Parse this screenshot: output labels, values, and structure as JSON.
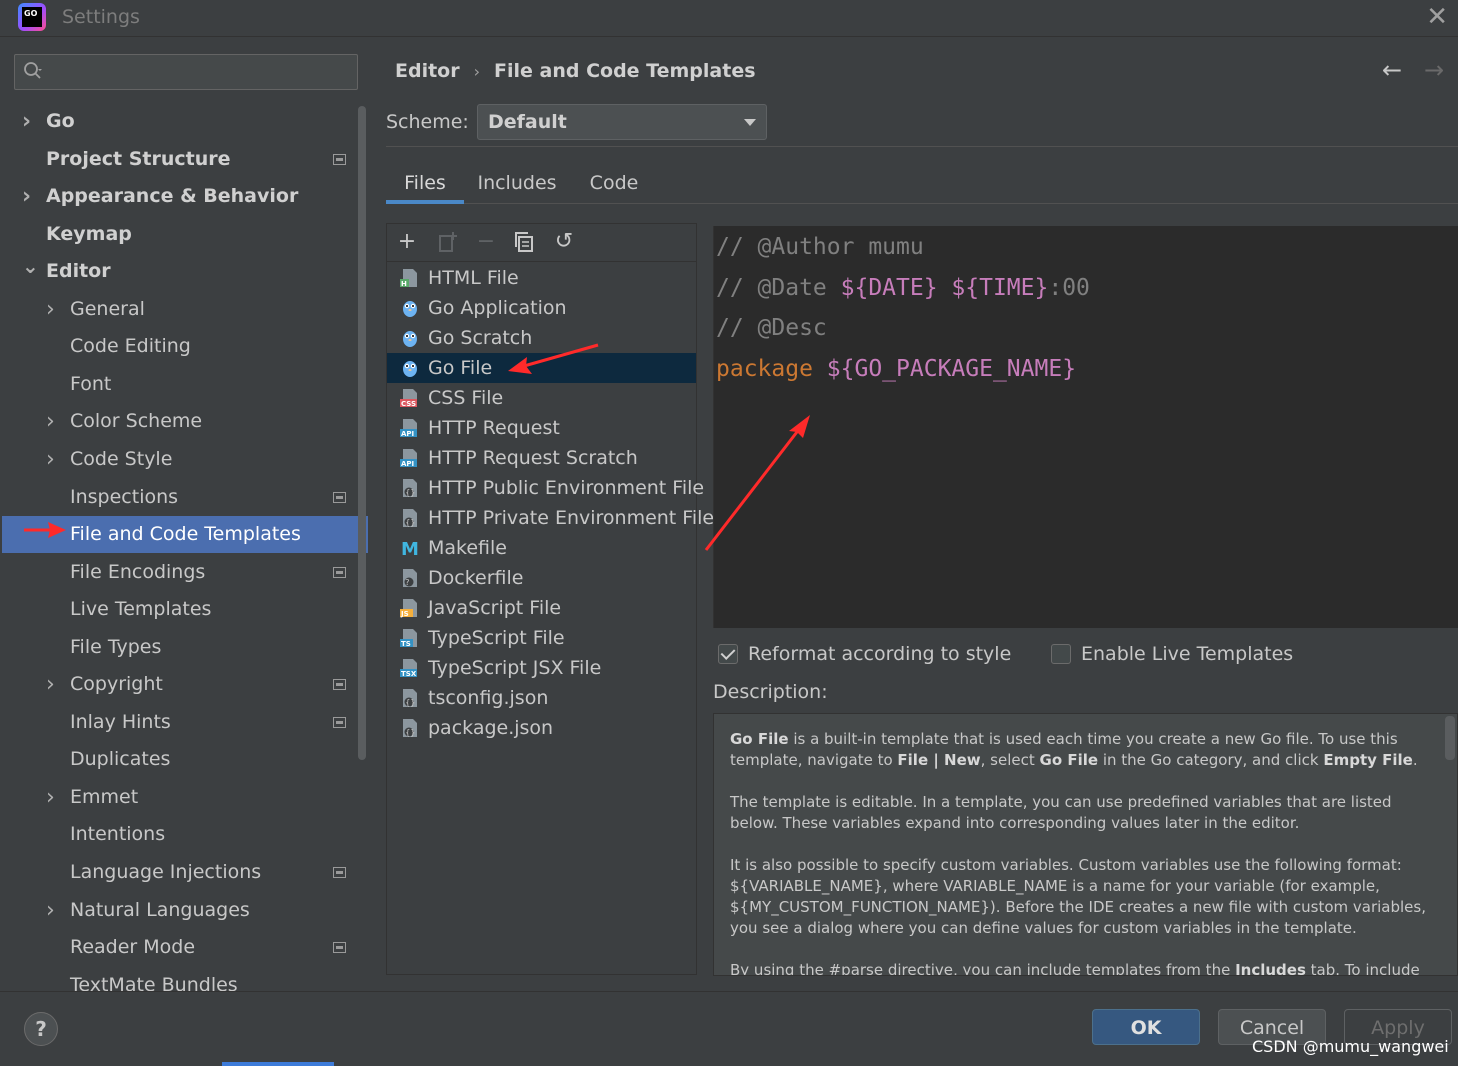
{
  "window": {
    "title": "Settings",
    "logo_text": "GO"
  },
  "sidebar": {
    "search_placeholder": "",
    "items": [
      {
        "label": "Go",
        "level": 0,
        "expandable": true,
        "expanded": false,
        "bold": true,
        "project_icon": false,
        "selected": false
      },
      {
        "label": "Project Structure",
        "level": 0,
        "expandable": false,
        "bold": true,
        "project_icon": true,
        "selected": false
      },
      {
        "label": "Appearance & Behavior",
        "level": 0,
        "expandable": true,
        "expanded": false,
        "bold": true,
        "project_icon": false,
        "selected": false
      },
      {
        "label": "Keymap",
        "level": 0,
        "expandable": false,
        "bold": true,
        "project_icon": false,
        "selected": false
      },
      {
        "label": "Editor",
        "level": 0,
        "expandable": true,
        "expanded": true,
        "bold": true,
        "project_icon": false,
        "selected": false
      },
      {
        "label": "General",
        "level": 1,
        "expandable": true,
        "expanded": false,
        "bold": false,
        "project_icon": false,
        "selected": false
      },
      {
        "label": "Code Editing",
        "level": 1,
        "expandable": false,
        "bold": false,
        "project_icon": false,
        "selected": false
      },
      {
        "label": "Font",
        "level": 1,
        "expandable": false,
        "bold": false,
        "project_icon": false,
        "selected": false
      },
      {
        "label": "Color Scheme",
        "level": 1,
        "expandable": true,
        "expanded": false,
        "bold": false,
        "project_icon": false,
        "selected": false
      },
      {
        "label": "Code Style",
        "level": 1,
        "expandable": true,
        "expanded": false,
        "bold": false,
        "project_icon": false,
        "selected": false
      },
      {
        "label": "Inspections",
        "level": 1,
        "expandable": false,
        "bold": false,
        "project_icon": true,
        "selected": false
      },
      {
        "label": "File and Code Templates",
        "level": 1,
        "expandable": false,
        "bold": false,
        "project_icon": false,
        "selected": true
      },
      {
        "label": "File Encodings",
        "level": 1,
        "expandable": false,
        "bold": false,
        "project_icon": true,
        "selected": false
      },
      {
        "label": "Live Templates",
        "level": 1,
        "expandable": false,
        "bold": false,
        "project_icon": false,
        "selected": false
      },
      {
        "label": "File Types",
        "level": 1,
        "expandable": false,
        "bold": false,
        "project_icon": false,
        "selected": false
      },
      {
        "label": "Copyright",
        "level": 1,
        "expandable": true,
        "expanded": false,
        "bold": false,
        "project_icon": true,
        "selected": false
      },
      {
        "label": "Inlay Hints",
        "level": 1,
        "expandable": false,
        "bold": false,
        "project_icon": true,
        "selected": false
      },
      {
        "label": "Duplicates",
        "level": 1,
        "expandable": false,
        "bold": false,
        "project_icon": false,
        "selected": false
      },
      {
        "label": "Emmet",
        "level": 1,
        "expandable": true,
        "expanded": false,
        "bold": false,
        "project_icon": false,
        "selected": false
      },
      {
        "label": "Intentions",
        "level": 1,
        "expandable": false,
        "bold": false,
        "project_icon": false,
        "selected": false
      },
      {
        "label": "Language Injections",
        "level": 1,
        "expandable": false,
        "bold": false,
        "project_icon": true,
        "selected": false
      },
      {
        "label": "Natural Languages",
        "level": 1,
        "expandable": true,
        "expanded": false,
        "bold": false,
        "project_icon": false,
        "selected": false
      },
      {
        "label": "Reader Mode",
        "level": 1,
        "expandable": false,
        "bold": false,
        "project_icon": true,
        "selected": false
      },
      {
        "label": "TextMate Bundles",
        "level": 1,
        "expandable": false,
        "bold": false,
        "project_icon": false,
        "selected": false
      }
    ]
  },
  "header": {
    "breadcrumb": [
      "Editor",
      "File and Code Templates"
    ],
    "breadcrumb_separator": "›",
    "nav_back": "←",
    "nav_forward": "→"
  },
  "scheme": {
    "label": "Scheme:",
    "value": "Default"
  },
  "tabs": [
    {
      "label": "Files",
      "active": true
    },
    {
      "label": "Includes",
      "active": false
    },
    {
      "label": "Code",
      "active": false
    }
  ],
  "toolbar": {
    "add": "+",
    "remove": "−",
    "reset": "↺"
  },
  "templates": [
    {
      "label": "HTML File",
      "icon": "html-file-icon",
      "tag": "H",
      "tag_color": "#59a869",
      "selected": false
    },
    {
      "label": "Go Application",
      "icon": "gopher-icon",
      "tag": "",
      "tag_color": "#6db3f2",
      "selected": false
    },
    {
      "label": "Go Scratch",
      "icon": "gopher-icon",
      "tag": "",
      "tag_color": "#6db3f2",
      "selected": false
    },
    {
      "label": "Go File",
      "icon": "gopher-icon",
      "tag": "",
      "tag_color": "#6db3f2",
      "selected": true
    },
    {
      "label": "CSS File",
      "icon": "css-file-icon",
      "tag": "CSS",
      "tag_color": "#db5860",
      "selected": false
    },
    {
      "label": "HTTP Request",
      "icon": "api-file-icon",
      "tag": "API",
      "tag_color": "#3592c4",
      "selected": false
    },
    {
      "label": "HTTP Request Scratch",
      "icon": "api-file-icon",
      "tag": "API",
      "tag_color": "#3592c4",
      "selected": false
    },
    {
      "label": "HTTP Public Environment File",
      "icon": "json-file-icon",
      "tag": "{}",
      "tag_color": "#9aa7b0",
      "selected": false
    },
    {
      "label": "HTTP Private Environment File",
      "icon": "json-file-icon",
      "tag": "{}",
      "tag_color": "#9aa7b0",
      "selected": false
    },
    {
      "label": "Makefile",
      "icon": "makefile-icon",
      "tag": "M",
      "tag_color": "#40b6e0",
      "selected": false
    },
    {
      "label": "Dockerfile",
      "icon": "dockerfile-icon",
      "tag": "?",
      "tag_color": "#9aa7b0",
      "selected": false
    },
    {
      "label": "JavaScript File",
      "icon": "js-file-icon",
      "tag": "JS",
      "tag_color": "#f4af3d",
      "selected": false
    },
    {
      "label": "TypeScript File",
      "icon": "ts-file-icon",
      "tag": "TS",
      "tag_color": "#3592c4",
      "selected": false
    },
    {
      "label": "TypeScript JSX File",
      "icon": "tsx-file-icon",
      "tag": "TSX",
      "tag_color": "#3592c4",
      "selected": false
    },
    {
      "label": "tsconfig.json",
      "icon": "json-file-icon",
      "tag": "{}",
      "tag_color": "#9aa7b0",
      "selected": false
    },
    {
      "label": "package.json",
      "icon": "json-file-icon",
      "tag": "{}",
      "tag_color": "#9aa7b0",
      "selected": false
    }
  ],
  "editor": {
    "lines": [
      [
        {
          "t": "// @Author mumu",
          "c": "c-comment"
        }
      ],
      [
        {
          "t": "// @Date ",
          "c": "c-comment"
        },
        {
          "t": "${DATE}",
          "c": "c-var"
        },
        {
          "t": " ",
          "c": "c-comment"
        },
        {
          "t": "${TIME}",
          "c": "c-var"
        },
        {
          "t": ":00",
          "c": "c-comment"
        }
      ],
      [
        {
          "t": "// @Desc",
          "c": "c-comment"
        }
      ],
      [
        {
          "t": "package",
          "c": "c-kw"
        },
        {
          "t": " ",
          "c": "c-comment"
        },
        {
          "t": "${GO_PACKAGE_NAME}",
          "c": "c-var"
        }
      ]
    ]
  },
  "options": {
    "reformat_label": "Reformat according to style",
    "reformat_checked": true,
    "live_templates_label": "Enable Live Templates",
    "live_templates_checked": false
  },
  "description": {
    "label": "Description:",
    "p1_b1": "Go File",
    "p1_t1": " is a built-in template that is used each time you create a new Go file. To use this template, navigate to ",
    "p1_b2": "File | New",
    "p1_t2": ", select ",
    "p1_b3": "Go File",
    "p1_t3": " in the Go category, and click ",
    "p1_b4": "Empty File",
    "p1_t4": ".",
    "p2": "The template is editable. In a template, you can use predefined variables that are listed below. These variables expand into corresponding values later in the editor.",
    "p3": "It is also possible to specify custom variables. Custom variables use the following format: ${VARIABLE_NAME}, where VARIABLE_NAME is a name for your variable (for example, ${MY_CUSTOM_FUNCTION_NAME}). Before the IDE creates a new file with custom variables, you see a dialog where you can define values for custom variables in the template.",
    "p4_t1": "By using the #parse directive, you can include templates from the ",
    "p4_b1": "Includes",
    "p4_t2": " tab. To include"
  },
  "footer": {
    "help": "?",
    "ok": "OK",
    "cancel": "Cancel",
    "apply": "Apply",
    "watermark": "CSDN @mumu_wangwei"
  },
  "colors": {
    "selection": "#4b6eaf",
    "annotation_arrow": "#ff2a2a",
    "ok_button": "#365880",
    "accent": "#3d7bd9"
  }
}
